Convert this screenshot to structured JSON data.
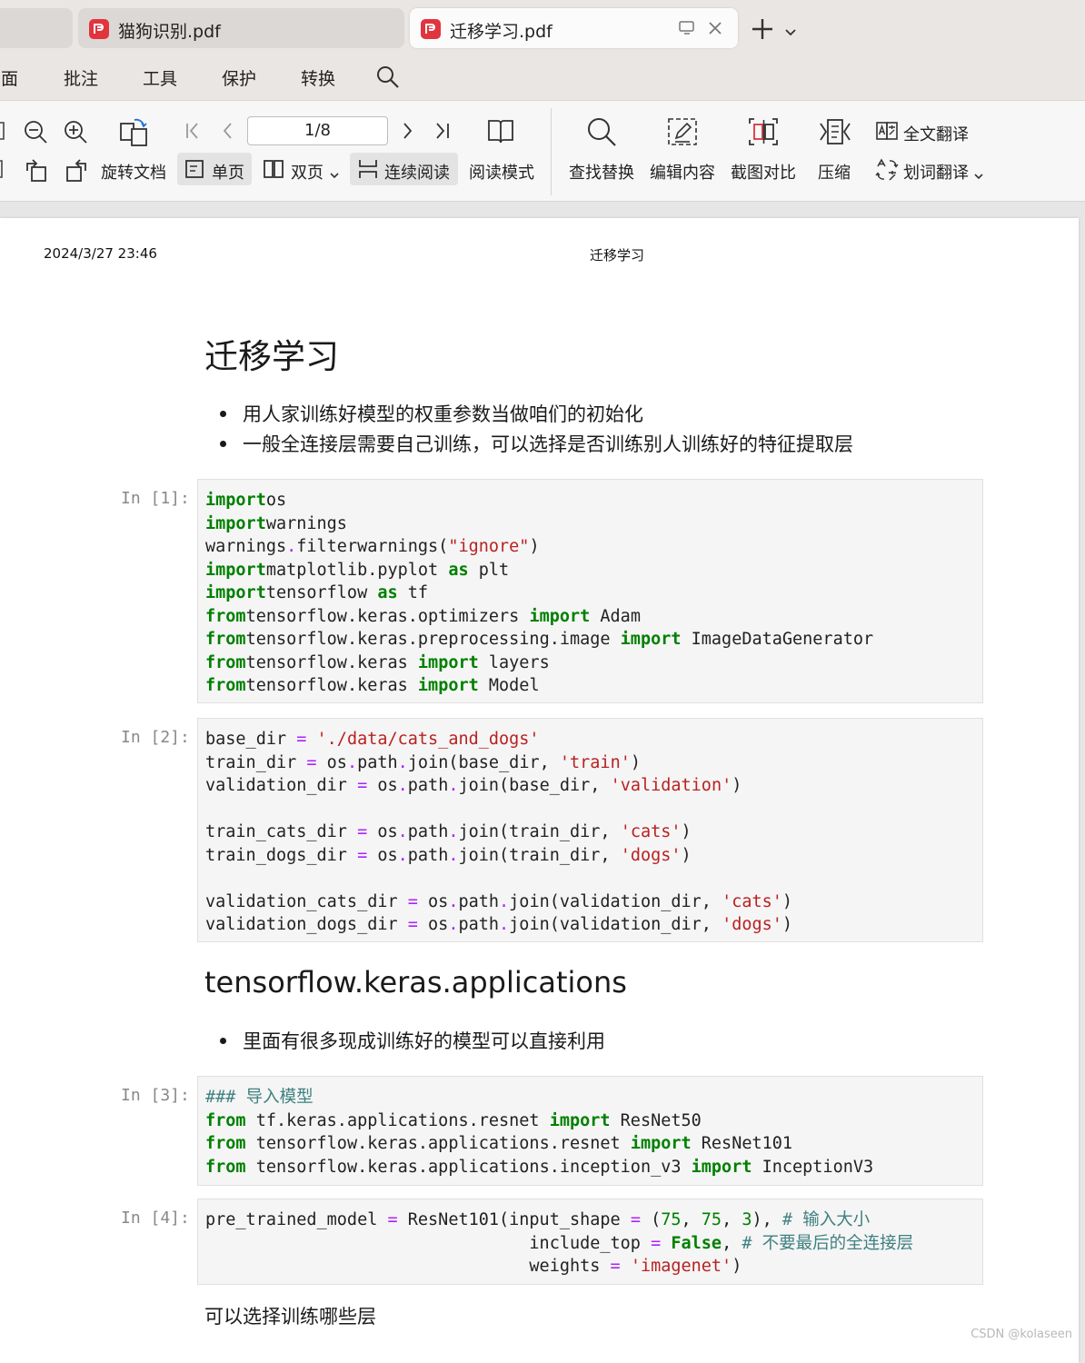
{
  "tabs": [
    {
      "label": ""
    },
    {
      "label": "猫狗识别.pdf"
    },
    {
      "label": "迁移学习.pdf"
    }
  ],
  "menu": [
    "页面",
    "批注",
    "工具",
    "保护",
    "转换"
  ],
  "toolbar": {
    "page_indicator": "1/8",
    "rotate_doc": "旋转文档",
    "single_page": "单页",
    "double_page": "双页",
    "continuous": "连续阅读",
    "reading_mode": "阅读模式",
    "find_replace": "查找替换",
    "edit_content": "编辑内容",
    "screenshot_compare": "截图对比",
    "compress": "压缩",
    "full_translate": "全文翻译",
    "word_translate": "划词翻译"
  },
  "document": {
    "header_date": "2024/3/27 23:46",
    "header_title": "迁移学习",
    "title": "迁移学习",
    "bullets1": [
      "用人家训练好模型的权重参数当做咱们的初始化",
      "一般全连接层需要自己训练，可以选择是否训练别人训练好的特征提取层"
    ],
    "section2_title": "tensorflow.keras.applications",
    "bullets2": [
      "里面有很多现成训练好的模型可以直接利用"
    ],
    "closing_text": "可以选择训练哪些层",
    "prompts": [
      "In [1]:",
      "In [2]:",
      "In [3]:",
      "In [4]:"
    ],
    "watermark": "CSDN @kolaseen"
  },
  "cells": [
    [
      [
        [
          "kw",
          "import"
        ],
        [
          "",
          "os"
        ]
      ],
      [
        [
          "kw",
          "import"
        ],
        [
          "",
          "warnings"
        ]
      ],
      [
        [
          "",
          "warnings"
        ],
        [
          "op",
          "."
        ],
        [
          "",
          "filterwarnings("
        ],
        [
          "str",
          "\"ignore\""
        ],
        [
          "",
          ")"
        ]
      ],
      [
        [
          "kw",
          "import"
        ],
        [
          "",
          "matplotlib.pyplot "
        ],
        [
          "kw",
          "as"
        ],
        [
          "",
          " plt"
        ]
      ],
      [
        [
          "kw",
          "import"
        ],
        [
          "",
          "tensorflow "
        ],
        [
          "kw",
          "as"
        ],
        [
          "",
          " tf"
        ]
      ],
      [
        [
          "kw",
          "from"
        ],
        [
          "",
          "tensorflow.keras.optimizers "
        ],
        [
          "kw",
          "import"
        ],
        [
          "",
          " Adam"
        ]
      ],
      [
        [
          "kw",
          "from"
        ],
        [
          "",
          "tensorflow.keras.preprocessing.image "
        ],
        [
          "kw",
          "import"
        ],
        [
          "",
          " ImageDataGenerator"
        ]
      ],
      [
        [
          "kw",
          "from"
        ],
        [
          "",
          "tensorflow.keras "
        ],
        [
          "kw",
          "import"
        ],
        [
          "",
          " layers"
        ]
      ],
      [
        [
          "kw",
          "from"
        ],
        [
          "",
          "tensorflow.keras "
        ],
        [
          "kw",
          "import"
        ],
        [
          "",
          " Model"
        ]
      ]
    ],
    [
      [
        [
          "",
          "base_dir "
        ],
        [
          "op",
          "="
        ],
        [
          "",
          " "
        ],
        [
          "str",
          "'./data/cats_and_dogs'"
        ]
      ],
      [
        [
          "",
          "train_dir "
        ],
        [
          "op",
          "="
        ],
        [
          "",
          " os"
        ],
        [
          "op",
          "."
        ],
        [
          "",
          "path"
        ],
        [
          "op",
          "."
        ],
        [
          "",
          "join(base_dir, "
        ],
        [
          "str",
          "'train'"
        ],
        [
          "",
          ")"
        ]
      ],
      [
        [
          "",
          "validation_dir "
        ],
        [
          "op",
          "="
        ],
        [
          "",
          " os"
        ],
        [
          "op",
          "."
        ],
        [
          "",
          "path"
        ],
        [
          "op",
          "."
        ],
        [
          "",
          "join(base_dir, "
        ],
        [
          "str",
          "'validation'"
        ],
        [
          "",
          ")"
        ]
      ],
      [],
      [
        [
          "",
          "train_cats_dir "
        ],
        [
          "op",
          "="
        ],
        [
          "",
          " os"
        ],
        [
          "op",
          "."
        ],
        [
          "",
          "path"
        ],
        [
          "op",
          "."
        ],
        [
          "",
          "join(train_dir, "
        ],
        [
          "str",
          "'cats'"
        ],
        [
          "",
          ")"
        ]
      ],
      [
        [
          "",
          "train_dogs_dir "
        ],
        [
          "op",
          "="
        ],
        [
          "",
          " os"
        ],
        [
          "op",
          "."
        ],
        [
          "",
          "path"
        ],
        [
          "op",
          "."
        ],
        [
          "",
          "join(train_dir, "
        ],
        [
          "str",
          "'dogs'"
        ],
        [
          "",
          ")"
        ]
      ],
      [],
      [
        [
          "",
          "validation_cats_dir "
        ],
        [
          "op",
          "="
        ],
        [
          "",
          " os"
        ],
        [
          "op",
          "."
        ],
        [
          "",
          "path"
        ],
        [
          "op",
          "."
        ],
        [
          "",
          "join(validation_dir, "
        ],
        [
          "str",
          "'cats'"
        ],
        [
          "",
          ")"
        ]
      ],
      [
        [
          "",
          "validation_dogs_dir "
        ],
        [
          "op",
          "="
        ],
        [
          "",
          " os"
        ],
        [
          "op",
          "."
        ],
        [
          "",
          "path"
        ],
        [
          "op",
          "."
        ],
        [
          "",
          "join(validation_dir, "
        ],
        [
          "str",
          "'dogs'"
        ],
        [
          "",
          ")"
        ]
      ]
    ],
    [
      [
        [
          "cm",
          "### "
        ],
        [
          "cm-cn",
          "导入模型"
        ]
      ],
      [
        [
          "kw",
          "from"
        ],
        [
          "",
          " tf.keras.applications.resnet "
        ],
        [
          "kw",
          "import"
        ],
        [
          "",
          " ResNet50"
        ]
      ],
      [
        [
          "kw",
          "from"
        ],
        [
          "",
          " tensorflow.keras.applications.resnet "
        ],
        [
          "kw",
          "import"
        ],
        [
          "",
          " ResNet101"
        ]
      ],
      [
        [
          "kw",
          "from"
        ],
        [
          "",
          " tensorflow.keras.applications.inception_v3 "
        ],
        [
          "kw",
          "import"
        ],
        [
          "",
          " InceptionV3"
        ]
      ]
    ],
    [
      [
        [
          "",
          "pre_trained_model "
        ],
        [
          "op",
          "="
        ],
        [
          "",
          " ResNet101(input_shape "
        ],
        [
          "op",
          "="
        ],
        [
          "",
          " ("
        ],
        [
          "num",
          "75"
        ],
        [
          "",
          ", "
        ],
        [
          "num",
          "75"
        ],
        [
          "",
          ", "
        ],
        [
          "num",
          "3"
        ],
        [
          "",
          "), "
        ],
        [
          "cm",
          "# "
        ],
        [
          "cm-cn",
          "输入大小"
        ]
      ],
      [
        [
          "",
          "                                include_top "
        ],
        [
          "op",
          "="
        ],
        [
          "",
          " "
        ],
        [
          "kw",
          "False"
        ],
        [
          "",
          ", "
        ],
        [
          "cm",
          "# "
        ],
        [
          "cm-cn",
          "不要最后的全连接层"
        ]
      ],
      [
        [
          "",
          "                                weights "
        ],
        [
          "op",
          "="
        ],
        [
          "",
          " "
        ],
        [
          "str",
          "'imagenet'"
        ],
        [
          "",
          ")"
        ]
      ]
    ]
  ]
}
